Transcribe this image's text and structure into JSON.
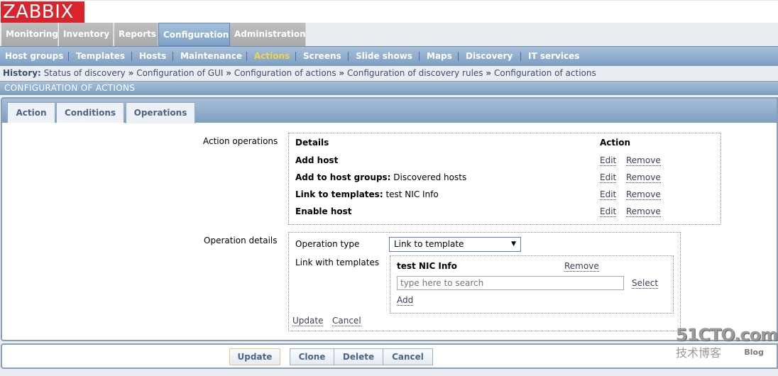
{
  "logo": "ZABBIX",
  "main_menu": [
    {
      "label": "Monitoring",
      "active": false
    },
    {
      "label": "Inventory",
      "active": false
    },
    {
      "label": "Reports",
      "active": false
    },
    {
      "label": "Configuration",
      "active": true
    },
    {
      "label": "Administration",
      "active": false
    }
  ],
  "sub_menu": [
    {
      "label": "Host groups",
      "active": false
    },
    {
      "label": "Templates",
      "active": false
    },
    {
      "label": "Hosts",
      "active": false
    },
    {
      "label": "Maintenance",
      "active": false
    },
    {
      "label": "Actions",
      "active": true
    },
    {
      "label": "Screens",
      "active": false
    },
    {
      "label": "Slide shows",
      "active": false
    },
    {
      "label": "Maps",
      "active": false
    },
    {
      "label": "Discovery",
      "active": false
    },
    {
      "label": "IT services",
      "active": false
    }
  ],
  "history": {
    "label": "History:",
    "separator": "»",
    "items": [
      "Status of discovery",
      "Configuration of GUI",
      "Configuration of actions",
      "Configuration of discovery rules",
      "Configuration of actions"
    ]
  },
  "page_title": "CONFIGURATION OF ACTIONS",
  "tabs": [
    {
      "label": "Action",
      "active": false
    },
    {
      "label": "Conditions",
      "active": false
    },
    {
      "label": "Operations",
      "active": true
    }
  ],
  "action_operations": {
    "label": "Action operations",
    "headers": {
      "details": "Details",
      "action": "Action"
    },
    "rows": [
      {
        "bold": "Add host",
        "rest": "",
        "edit": "Edit",
        "remove": "Remove"
      },
      {
        "bold": "Add to host groups:",
        "rest": " Discovered hosts",
        "edit": "Edit",
        "remove": "Remove"
      },
      {
        "bold": "Link to templates:",
        "rest": " test NIC Info",
        "edit": "Edit",
        "remove": "Remove"
      },
      {
        "bold": "Enable host",
        "rest": "",
        "edit": "Edit",
        "remove": "Remove"
      }
    ]
  },
  "operation_details": {
    "label": "Operation details",
    "operation_type_label": "Operation type",
    "operation_type_value": "Link to template",
    "link_with_templates_label": "Link with templates",
    "template_name": "test NIC Info",
    "remove_label": "Remove",
    "search_placeholder": "type here to search",
    "select_label": "Select",
    "add_label": "Add",
    "update_label": "Update",
    "cancel_label": "Cancel"
  },
  "footer_buttons": {
    "update": "Update",
    "clone": "Clone",
    "delete": "Delete",
    "cancel": "Cancel"
  },
  "watermark": {
    "line1": "51CTO.com",
    "line2": "技术博客",
    "line3": "Blog"
  }
}
